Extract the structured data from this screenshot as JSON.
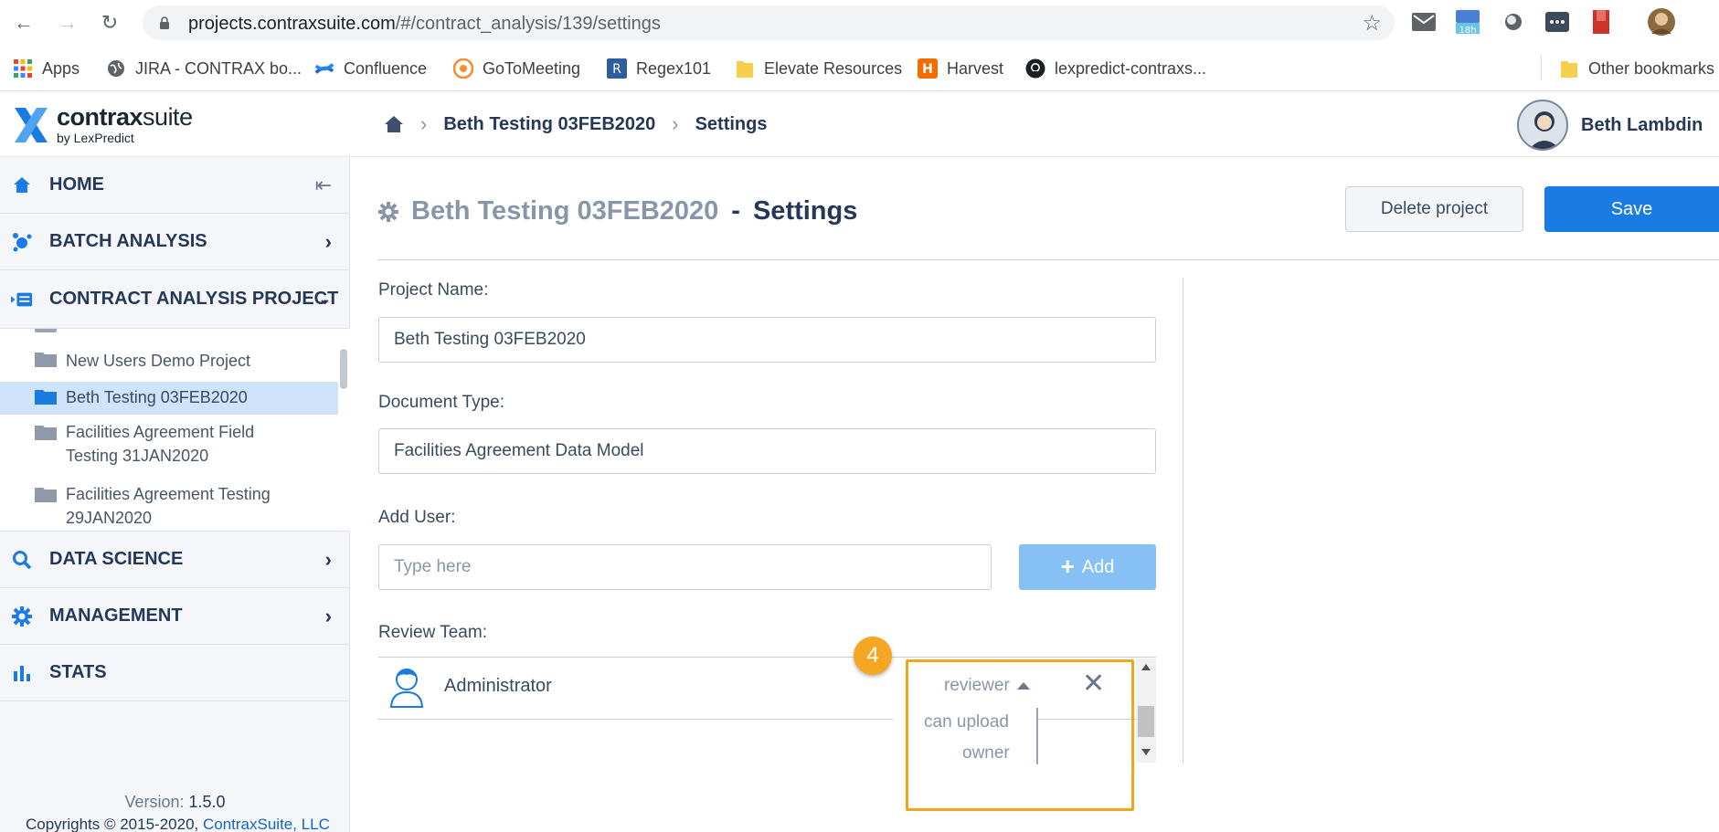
{
  "browser": {
    "url_domain": "projects.contraxsuite.com",
    "url_path": "/#/contract_analysis/139/settings",
    "calendar_badge": "18h"
  },
  "bookmarks": [
    {
      "label": "Apps",
      "icon": "apps-grid-icon"
    },
    {
      "label": "JIRA - CONTRAX bo...",
      "icon": "globe-icon"
    },
    {
      "label": "Confluence",
      "icon": "confluence-icon"
    },
    {
      "label": "GoToMeeting",
      "icon": "gotomeeting-icon"
    },
    {
      "label": "Regex101",
      "icon": "regex101-icon"
    },
    {
      "label": "Elevate Resources",
      "icon": "folder-icon"
    },
    {
      "label": "Harvest",
      "icon": "harvest-icon"
    },
    {
      "label": "lexpredict-contraxs...",
      "icon": "github-icon"
    }
  ],
  "other_bookmarks": "Other bookmarks",
  "app": {
    "logo_main_bold": "contrax",
    "logo_main_light": "suite",
    "logo_sub": "by LexPredict",
    "breadcrumbs": [
      "Beth Testing 03FEB2020",
      "Settings"
    ],
    "user_name": "Beth Lambdin"
  },
  "sidebar": {
    "home": "HOME",
    "batch_analysis": "BATCH ANALYSIS",
    "contract_analysis": "CONTRACT ANALYSIS PROJECT",
    "projects": [
      {
        "name": "New Users Demo Project"
      },
      {
        "name": "Beth Testing 03FEB2020"
      },
      {
        "name": "Facilities Agreement Field",
        "name2": "Testing 31JAN2020"
      },
      {
        "name": "Facilities Agreement Testing",
        "name2": "29JAN2020"
      }
    ],
    "data_science": "DATA SCIENCE",
    "management": "MANAGEMENT",
    "stats": "STATS",
    "version_label": "Version:",
    "version_value": "1.5.0",
    "copyright": "Copyrights © 2015-2020,",
    "copyright_link": "ContraxSuite, LLC"
  },
  "settings": {
    "title_name": "Beth Testing 03FEB2020",
    "title_dash": "-",
    "title_settings": "Settings",
    "delete_label": "Delete project",
    "save_label": "Save",
    "project_name_label": "Project Name:",
    "project_name_value": "Beth Testing 03FEB2020",
    "doc_type_label": "Document Type:",
    "doc_type_value": "Facilities Agreement Data Model",
    "add_user_label": "Add User:",
    "add_user_placeholder": "Type here",
    "add_button": "Add",
    "review_team_label": "Review Team:",
    "members": [
      {
        "name": "Administrator",
        "role": "reviewer"
      }
    ],
    "role_options": [
      "can upload",
      "owner"
    ],
    "step_number": "4"
  },
  "colors": {
    "primary": "#1a7be3",
    "highlight": "#f0a71d",
    "active_project_bg": "#cfe3fb"
  }
}
